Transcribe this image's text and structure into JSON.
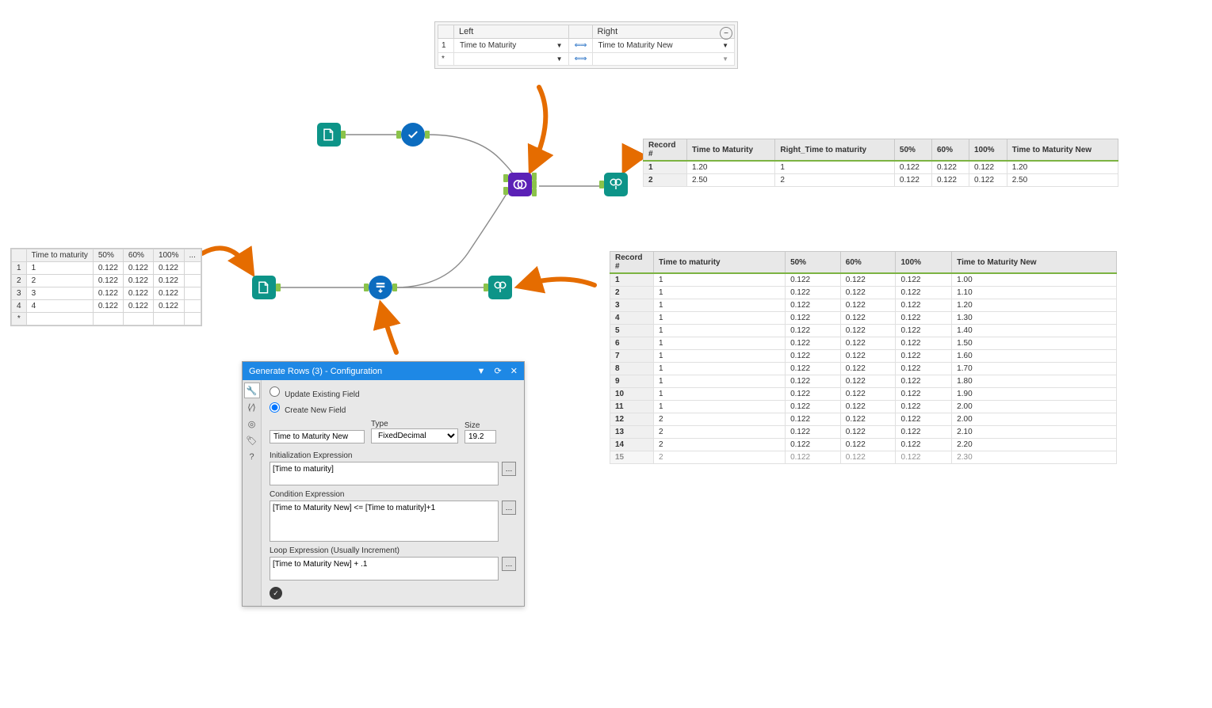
{
  "join_config": {
    "col_left": "Left",
    "col_right": "Right",
    "rows": [
      {
        "num": "1",
        "left": "Time to Maturity",
        "right": "Time to Maturity New"
      },
      {
        "num": "*",
        "left": "",
        "right": ""
      }
    ]
  },
  "mini_table": {
    "headers": [
      "",
      "Time to maturity",
      "50%",
      "60%",
      "100%",
      "..."
    ],
    "rows": [
      [
        "1",
        "1",
        "0.122",
        "0.122",
        "0.122"
      ],
      [
        "2",
        "2",
        "0.122",
        "0.122",
        "0.122"
      ],
      [
        "3",
        "3",
        "0.122",
        "0.122",
        "0.122"
      ],
      [
        "4",
        "4",
        "0.122",
        "0.122",
        "0.122"
      ],
      [
        "*",
        "",
        "",
        "",
        ""
      ]
    ]
  },
  "result_top": {
    "headers": [
      "Record #",
      "Time to Maturity",
      "Right_Time to maturity",
      "50%",
      "60%",
      "100%",
      "Time to Maturity New"
    ],
    "rows": [
      [
        "1",
        "1.20",
        "1",
        "0.122",
        "0.122",
        "0.122",
        "1.20"
      ],
      [
        "2",
        "2.50",
        "2",
        "0.122",
        "0.122",
        "0.122",
        "2.50"
      ]
    ]
  },
  "result_bot": {
    "headers": [
      "Record #",
      "Time to maturity",
      "50%",
      "60%",
      "100%",
      "Time to Maturity New"
    ],
    "rows": [
      [
        "1",
        "1",
        "0.122",
        "0.122",
        "0.122",
        "1.00"
      ],
      [
        "2",
        "1",
        "0.122",
        "0.122",
        "0.122",
        "1.10"
      ],
      [
        "3",
        "1",
        "0.122",
        "0.122",
        "0.122",
        "1.20"
      ],
      [
        "4",
        "1",
        "0.122",
        "0.122",
        "0.122",
        "1.30"
      ],
      [
        "5",
        "1",
        "0.122",
        "0.122",
        "0.122",
        "1.40"
      ],
      [
        "6",
        "1",
        "0.122",
        "0.122",
        "0.122",
        "1.50"
      ],
      [
        "7",
        "1",
        "0.122",
        "0.122",
        "0.122",
        "1.60"
      ],
      [
        "8",
        "1",
        "0.122",
        "0.122",
        "0.122",
        "1.70"
      ],
      [
        "9",
        "1",
        "0.122",
        "0.122",
        "0.122",
        "1.80"
      ],
      [
        "10",
        "1",
        "0.122",
        "0.122",
        "0.122",
        "1.90"
      ],
      [
        "11",
        "1",
        "0.122",
        "0.122",
        "0.122",
        "2.00"
      ],
      [
        "12",
        "2",
        "0.122",
        "0.122",
        "0.122",
        "2.00"
      ],
      [
        "13",
        "2",
        "0.122",
        "0.122",
        "0.122",
        "2.10"
      ],
      [
        "14",
        "2",
        "0.122",
        "0.122",
        "0.122",
        "2.20"
      ],
      [
        "15",
        "2",
        "0.122",
        "0.122",
        "0.122",
        "2.30"
      ]
    ]
  },
  "config_window": {
    "title": "Generate Rows (3) - Configuration",
    "update_label": "Update Existing Field",
    "create_label": "Create New  Field",
    "type_label": "Type",
    "size_label": "Size",
    "field_name": "Time to Maturity New",
    "type_value": "FixedDecimal",
    "size_value": "19.2",
    "init_label": "Initialization Expression",
    "init_expr": "[Time to maturity]",
    "cond_label": "Condition Expression",
    "cond_expr": "[Time to Maturity New] <= [Time to maturity]+1",
    "loop_label": "Loop Expression (Usually Increment)",
    "loop_expr": "[Time to Maturity New] + .1"
  }
}
